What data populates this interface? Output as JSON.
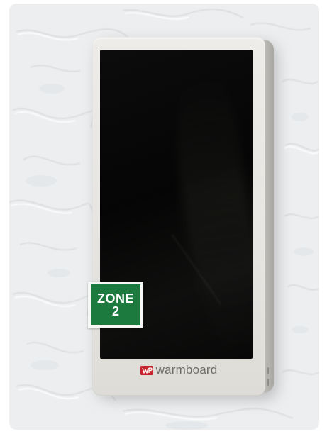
{
  "scene": {
    "wall_color": "#eceeef",
    "device_color": "#e8e6e2",
    "screen_color": "#050505"
  },
  "zone_label": {
    "line1": "ZONE",
    "line2": "2",
    "color": "#1d7a3e"
  },
  "brand": {
    "name": "warmboard",
    "icon": "warmboard-logo-icon",
    "icon_color": "#c8232c",
    "text_color": "#6f6d6a"
  }
}
